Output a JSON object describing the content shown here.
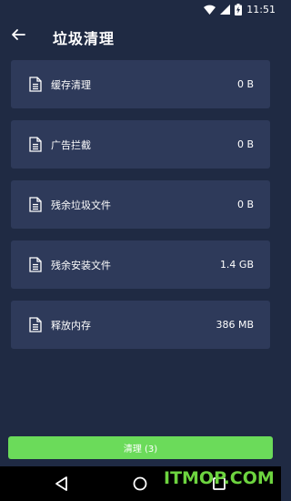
{
  "status_bar": {
    "time": "11:51",
    "icons": [
      "signal-icon",
      "wifi-icon",
      "battery-charging-icon"
    ]
  },
  "app_bar": {
    "back_icon": "arrow-left-icon",
    "title": "垃圾清理"
  },
  "items": [
    {
      "label": "缓存清理",
      "size": "0 B",
      "icon": "document-icon"
    },
    {
      "label": "广告拦截",
      "size": "0 B",
      "icon": "document-icon"
    },
    {
      "label": "残余垃圾文件",
      "size": "0 B",
      "icon": "document-icon"
    },
    {
      "label": "残余安装文件",
      "size": "1.4 GB",
      "icon": "document-icon"
    },
    {
      "label": "释放内存",
      "size": "386 MB",
      "icon": "document-icon"
    }
  ],
  "clean_button": {
    "label": "清理 (3)",
    "color": "#6bdb5a"
  },
  "nav_bar": {
    "icons": [
      "nav-back-icon",
      "nav-home-icon",
      "nav-recents-icon"
    ]
  },
  "watermark": "ITMOP.COM",
  "colors": {
    "background": "#1f2a43",
    "card": "#2e3a5a",
    "accent": "#6bdb5a"
  }
}
